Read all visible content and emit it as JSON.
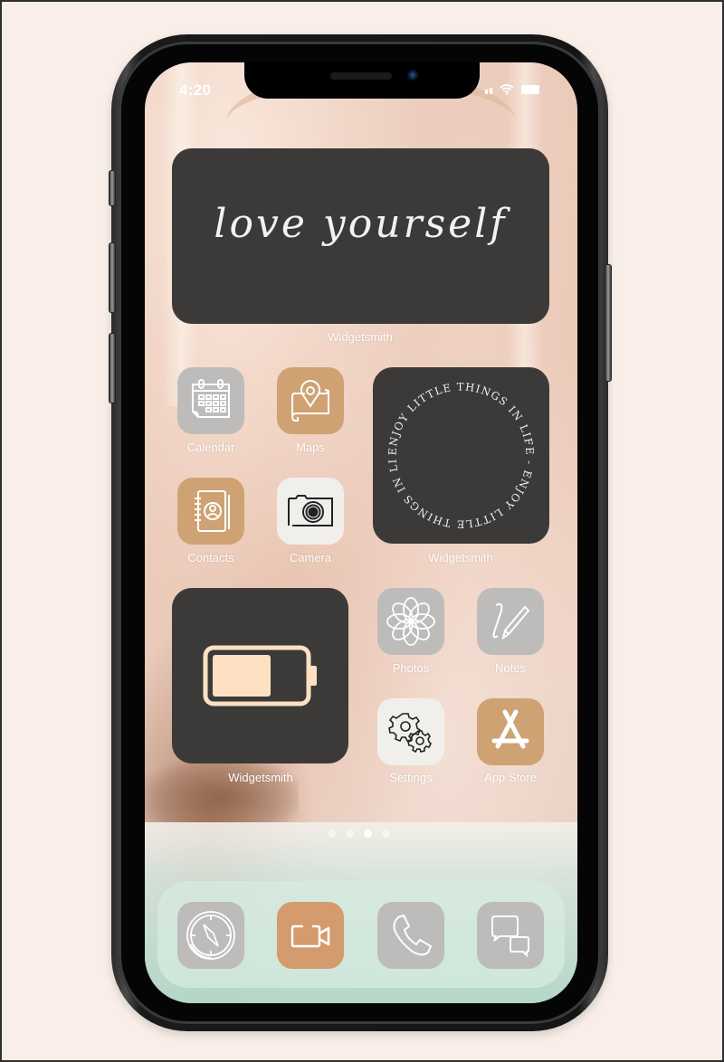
{
  "status_bar": {
    "time": "4:20",
    "signal_icon": "cellular-signal-icon",
    "wifi_icon": "wifi-icon",
    "battery_icon": "battery-icon"
  },
  "widgets": {
    "quote": {
      "text": "love yourself",
      "label": "Widgetsmith"
    },
    "circle_text": {
      "text": "ENJOY LITTLE THINGS IN LIFE - ENJOY LITTLE THINGS IN LIFE - ",
      "label": "Widgetsmith"
    },
    "battery": {
      "label": "Widgetsmith",
      "level_percent": 65,
      "color": "#fde0c2"
    }
  },
  "apps": {
    "calendar": {
      "label": "Calendar",
      "icon": "calendar-icon"
    },
    "maps": {
      "label": "Maps",
      "icon": "map-pin-icon"
    },
    "contacts": {
      "label": "Contacts",
      "icon": "contacts-book-icon"
    },
    "camera": {
      "label": "Camera",
      "icon": "camera-icon"
    },
    "photos": {
      "label": "Photos",
      "icon": "flower-icon"
    },
    "notes": {
      "label": "Notes",
      "icon": "pen-icon"
    },
    "settings": {
      "label": "Settings",
      "icon": "gears-icon"
    },
    "app_store": {
      "label": "App Store",
      "icon": "app-store-icon"
    }
  },
  "page_indicator": {
    "count": 4,
    "active_index": 2
  },
  "dock": [
    {
      "name": "Safari",
      "icon": "compass-icon"
    },
    {
      "name": "FaceTime",
      "icon": "video-camera-icon"
    },
    {
      "name": "Phone",
      "icon": "phone-icon"
    },
    {
      "name": "Messages",
      "icon": "chat-bubbles-icon"
    }
  ],
  "colors": {
    "widget_bg": "#3b3a39",
    "icon_gray": "#bdbcbb",
    "icon_tan": "#cfa274",
    "icon_cream": "#f1efec",
    "icon_orange": "#d39b6e",
    "page_bg": "#f9eee8"
  }
}
